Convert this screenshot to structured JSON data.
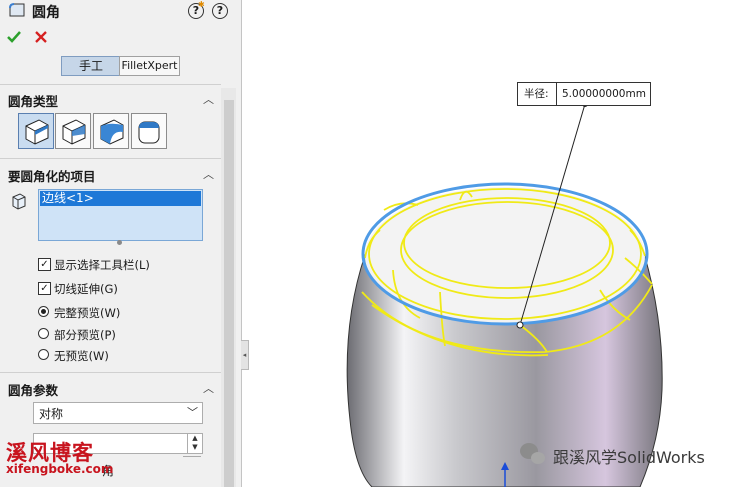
{
  "panel": {
    "title": "圆角",
    "help_glyph": "?",
    "ok_icon": "check-icon",
    "cancel_icon": "x-icon",
    "tabs": [
      {
        "label": "手工",
        "active": true
      },
      {
        "label": "FilletXpert",
        "active": false
      }
    ]
  },
  "fillet_type": {
    "header": "圆角类型",
    "options": [
      "constant-size-fillet-icon",
      "variable-size-fillet-icon",
      "face-fillet-icon",
      "full-round-fillet-icon"
    ],
    "selected_index": 0
  },
  "items_to_fillet": {
    "header": "要圆角化的项目",
    "list_items": [
      "边线<1>"
    ],
    "checkboxes": [
      {
        "label": "显示选择工具栏(L)",
        "checked": true
      },
      {
        "label": "切线延伸(G)",
        "checked": true
      }
    ],
    "radios": [
      {
        "label": "完整预览(W)",
        "selected": true
      },
      {
        "label": "部分预览(P)",
        "selected": false
      },
      {
        "label": "无预览(W)",
        "selected": false
      }
    ]
  },
  "fillet_params": {
    "header": "圆角参数",
    "method_value": "对称",
    "partial_label": "角"
  },
  "viewport": {
    "callout_label": "半径:",
    "callout_value": "5.00000000mm",
    "selection_color": "#4f9be6",
    "preview_color": "#f0ea16"
  },
  "watermarks": {
    "brand_cn": "溪风博客",
    "brand_url": "xifengboke.com",
    "wechat_text": "跟溪风学SolidWorks"
  }
}
